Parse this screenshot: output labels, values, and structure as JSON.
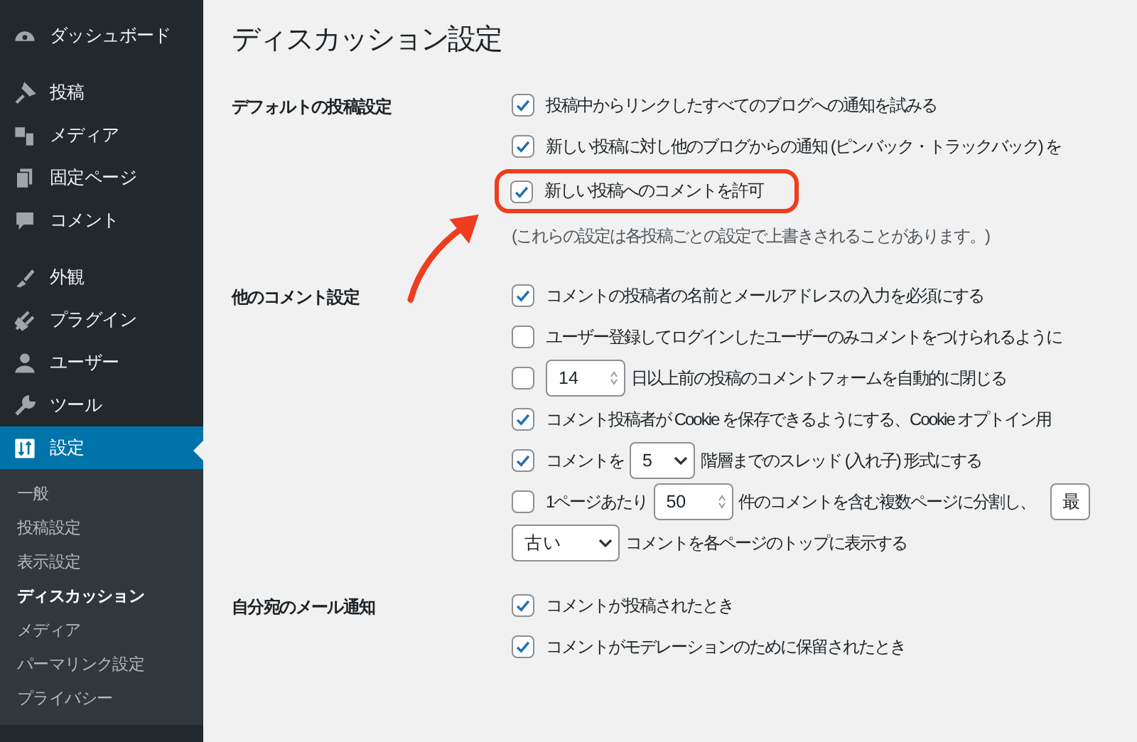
{
  "sidebar": {
    "groups": [
      [
        {
          "label": "ダッシュボード",
          "selected": false
        }
      ],
      [
        {
          "label": "投稿",
          "selected": false
        },
        {
          "label": "メディア",
          "selected": false
        },
        {
          "label": "固定ページ",
          "selected": false
        },
        {
          "label": "コメント",
          "selected": false
        }
      ],
      [
        {
          "label": "外観",
          "selected": false
        },
        {
          "label": "プラグイン",
          "selected": false
        },
        {
          "label": "ユーザー",
          "selected": false
        },
        {
          "label": "ツール",
          "selected": false
        },
        {
          "label": "設定",
          "selected": true
        }
      ]
    ],
    "submenu": [
      {
        "label": "一般",
        "selected": false
      },
      {
        "label": "投稿設定",
        "selected": false
      },
      {
        "label": "表示設定",
        "selected": false
      },
      {
        "label": "ディスカッション",
        "selected": true
      },
      {
        "label": "メディア",
        "selected": false
      },
      {
        "label": "パーマリンク設定",
        "selected": false
      },
      {
        "label": "プライバシー",
        "selected": false
      }
    ]
  },
  "page_title": "ディスカッション設定",
  "sections": [
    {
      "label": "デフォルトの投稿設定",
      "rows": [
        {
          "kind": "checkbox",
          "checked": true,
          "highlighted": false,
          "parts": [
            {
              "kind": "text",
              "text": "投稿中からリンクしたすべてのブログへの通知を試みる"
            }
          ]
        },
        {
          "kind": "checkbox",
          "checked": true,
          "highlighted": false,
          "parts": [
            {
              "kind": "text",
              "text": "新しい投稿に対し他のブログからの通知 (ピンバック・トラックバック) を"
            }
          ]
        },
        {
          "kind": "checkbox",
          "checked": true,
          "highlighted": true,
          "parts": [
            {
              "kind": "text",
              "text": "新しい投稿へのコメントを許可"
            }
          ]
        },
        {
          "kind": "note",
          "parts": [
            {
              "kind": "text",
              "text": "(これらの設定は各投稿ごとの設定で上書きされることがあります。)"
            }
          ]
        }
      ]
    },
    {
      "label": "他のコメント設定",
      "rows": [
        {
          "kind": "checkbox",
          "checked": true,
          "highlighted": false,
          "parts": [
            {
              "kind": "text",
              "text": "コメントの投稿者の名前とメールアドレスの入力を必須にする"
            }
          ]
        },
        {
          "kind": "checkbox",
          "checked": false,
          "highlighted": false,
          "parts": [
            {
              "kind": "text",
              "text": "ユーザー登録してログインしたユーザーのみコメントをつけられるように"
            }
          ]
        },
        {
          "kind": "checkbox",
          "checked": false,
          "highlighted": false,
          "parts": [
            {
              "kind": "number",
              "value": "14"
            },
            {
              "kind": "text",
              "text": "日以上前の投稿のコメントフォームを自動的に閉じる"
            }
          ]
        },
        {
          "kind": "checkbox",
          "checked": true,
          "highlighted": false,
          "parts": [
            {
              "kind": "text",
              "text": "コメント投稿者が Cookie を保存できるようにする、Cookie オプトイン用"
            }
          ]
        },
        {
          "kind": "checkbox",
          "checked": true,
          "highlighted": false,
          "parts": [
            {
              "kind": "text",
              "text": "コメントを"
            },
            {
              "kind": "select",
              "value": "5"
            },
            {
              "kind": "text",
              "text": "階層までのスレッド (入れ子) 形式にする"
            }
          ]
        },
        {
          "kind": "checkbox",
          "checked": false,
          "highlighted": false,
          "parts": [
            {
              "kind": "text",
              "text": "1ページあたり"
            },
            {
              "kind": "number",
              "value": "50"
            },
            {
              "kind": "text",
              "text": "件のコメントを含む複数ページに分割し、"
            },
            {
              "kind": "cutbox",
              "value": "最"
            }
          ]
        },
        {
          "kind": "plain",
          "parts": [
            {
              "kind": "select",
              "value": "古い"
            },
            {
              "kind": "text",
              "text": "コメントを各ページのトップに表示する"
            }
          ]
        }
      ]
    },
    {
      "label": "自分宛のメール通知",
      "rows": [
        {
          "kind": "checkbox",
          "checked": true,
          "highlighted": false,
          "parts": [
            {
              "kind": "text",
              "text": "コメントが投稿されたとき"
            }
          ]
        },
        {
          "kind": "checkbox",
          "checked": true,
          "highlighted": false,
          "parts": [
            {
              "kind": "text",
              "text": "コメントがモデレーションのために保留されたとき"
            }
          ]
        }
      ]
    }
  ]
}
